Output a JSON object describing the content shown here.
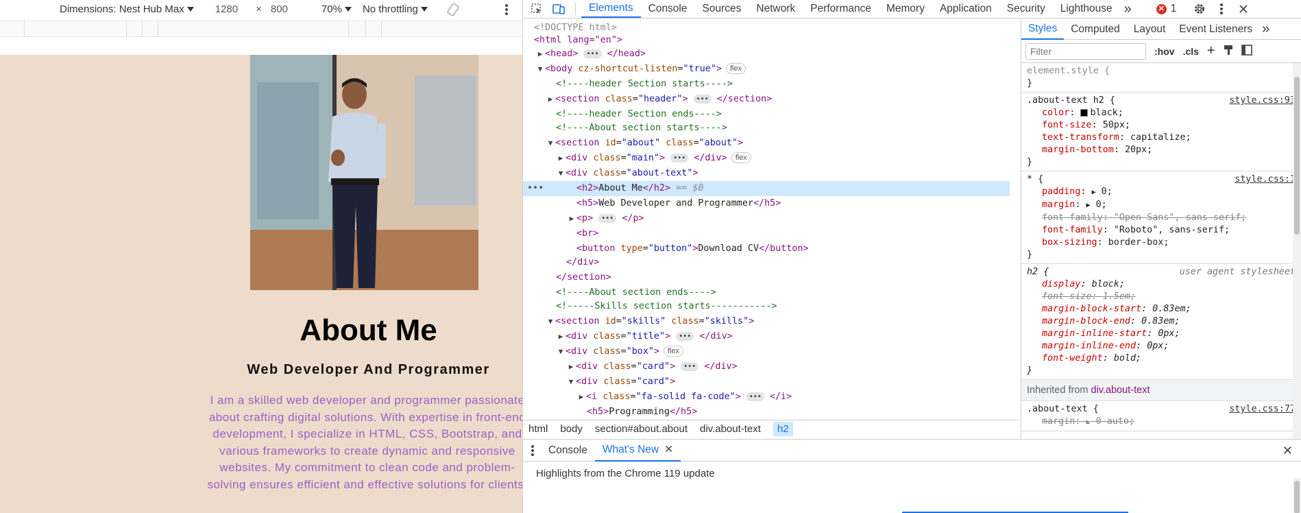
{
  "device_toolbar": {
    "dimensions_label": "Dimensions: Nest Hub Max",
    "width": "1280",
    "times": "×",
    "height": "800",
    "zoom": "70%",
    "throttle": "No throttling"
  },
  "page": {
    "about_title": "About Me",
    "about_subtitle": "Web Developer And Programmer",
    "about_paragraph": "I am a skilled web developer and programmer passionate about crafting digital solutions. With expertise in front-end development, I specialize in HTML, CSS, Bootstrap, and various frameworks to create dynamic and responsive websites. My commitment to clean code and problem-solving ensures efficient and effective solutions for clients.",
    "background_color": "#eddccb",
    "paragraph_color": "#9d5fc7"
  },
  "devtools": {
    "tabs": [
      "Elements",
      "Console",
      "Sources",
      "Network",
      "Performance",
      "Memory",
      "Application",
      "Security",
      "Lighthouse"
    ],
    "more_tabs": "»",
    "error_count": "1",
    "dom": {
      "doctype": "<!DOCTYPE html>",
      "html_open": "<html lang=\"en\">",
      "head": "head",
      "body_attr_name": "cz-shortcut-listen",
      "body_attr_value": "\"true\"",
      "flex": "flex",
      "c_header_start": "<!----header Section starts---->",
      "section_header_class": "\"header\"",
      "c_header_end": "<!----header Section ends---->",
      "c_about_start": "<!----About section starts---->",
      "about_id": "\"about\"",
      "about_class": "\"about\"",
      "main_class": "\"main\"",
      "about_text_class": "\"about-text\"",
      "h2_text": "About Me",
      "selected_marker": "== $0",
      "h5_text": "Web Developer and Programmer",
      "button_type": "\"button\"",
      "button_text": "Download CV",
      "c_about_end": "<!----About section ends---->",
      "c_skills_start": "<!-----Skills section starts----------->",
      "skills_id": "\"skills\"",
      "skills_class": "\"skills\"",
      "title_class": "\"title\"",
      "box_class": "\"box\"",
      "card_class": "\"card\"",
      "icon_class": "\"fa-solid fa-code\"",
      "h5_programming": "Programming"
    },
    "breadcrumbs": [
      "html",
      "body",
      "section#about.about",
      "div.about-text",
      "h2"
    ],
    "styles_tabs": [
      "Styles",
      "Computed",
      "Layout",
      "Event Listeners"
    ],
    "filter_placeholder": "Filter",
    "filter_tools": [
      ":hov",
      ".cls",
      "+"
    ],
    "rules": {
      "element_style": "element.style {",
      "close": "}",
      "r1_selector": ".about-text h2 {",
      "r1_source": "style.css:93",
      "r1_decls": [
        {
          "name": "color",
          "value": "black;"
        },
        {
          "name": "font-size",
          "value": "50px;"
        },
        {
          "name": "text-transform",
          "value": "capitalize;"
        },
        {
          "name": "margin-bottom",
          "value": "20px;"
        }
      ],
      "r2_selector": "* {",
      "r2_source": "style.css:1",
      "r2_padding": "padding",
      "r2_padding_v": "0;",
      "r2_margin": "margin",
      "r2_margin_v": "0;",
      "r2_ff1": "font-family",
      "r2_ff1_v": "\"Open Sans\", sans-serif;",
      "r2_ff2": "font-family",
      "r2_ff2_v": "\"Roboto\", sans-serif;",
      "r2_bs": "box-sizing",
      "r2_bs_v": "border-box;",
      "r3_selector": "h2 {",
      "r3_source": "user agent stylesheet",
      "r3_decls": [
        {
          "name": "display",
          "value": "block;"
        },
        {
          "name": "font-size",
          "value": "1.5em;"
        },
        {
          "name": "margin-block-start",
          "value": "0.83em;"
        },
        {
          "name": "margin-block-end",
          "value": "0.83em;"
        },
        {
          "name": "margin-inline-start",
          "value": "0px;"
        },
        {
          "name": "margin-inline-end",
          "value": "0px;"
        },
        {
          "name": "font-weight",
          "value": "bold;"
        }
      ],
      "inherited_label": "Inherited from",
      "inherited_from": "div.about-text",
      "r4_selector": ".about-text {",
      "r4_source": "style.css:77",
      "r4_decl_name": "margin",
      "r4_decl_value": "0 auto;"
    },
    "drawer": {
      "tabs": [
        "Console",
        "What's New"
      ],
      "highlights": "Highlights from the Chrome 119 update"
    }
  }
}
